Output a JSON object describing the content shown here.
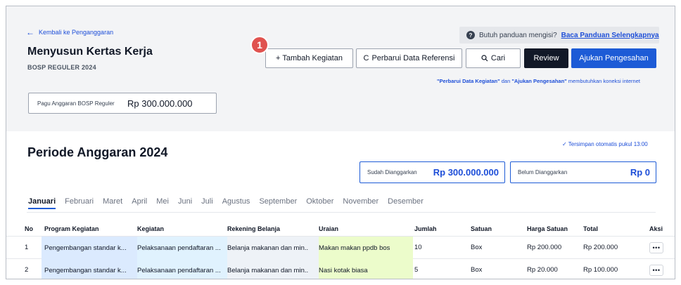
{
  "header": {
    "back_link": "Kembali ke Penganggaran",
    "title": "Menyusun Kertas Kerja",
    "subtitle": "BOSP REGULER 2024"
  },
  "help": {
    "text": "Butuh panduan mengisi?",
    "link": "Baca Panduan Selengkapnya"
  },
  "toolbar": {
    "add_label": "+ Tambah Kegiatan",
    "refresh_label": "Perbarui Data Referensi",
    "search_label": "Cari",
    "review_label": "Review",
    "submit_label": "Ajukan Pengesahan",
    "badge_number": "1"
  },
  "network_note": {
    "part1": "\"Perbarui Data Kegiatan\"",
    "part2": " dan ",
    "part3": "\"Ajukan Pengesahan\"",
    "part4": " membutuhkan koneksi internet"
  },
  "pagu": {
    "label": "Pagu Anggaran BOSP Reguler",
    "value": "Rp 300.000.000"
  },
  "period": {
    "title": "Periode Anggaran 2024",
    "autosave": "✓ Tersimpan otomatis pukul 13:00",
    "done_label": "Sudah Dianggarkan",
    "done_value": "Rp 300.000.000",
    "remain_label": "Belum Dianggarkan",
    "remain_value": "Rp 0"
  },
  "months": [
    "Januari",
    "Februari",
    "Maret",
    "April",
    "Mei",
    "Juni",
    "Juli",
    "Agustus",
    "September",
    "Oktober",
    "November",
    "Desember"
  ],
  "table": {
    "headers": {
      "no": "No",
      "program": "Program Kegiatan",
      "kegiatan": "Kegiatan",
      "rekening": "Rekening Belanja",
      "uraian": "Uraian",
      "jumlah": "Jumlah",
      "satuan": "Satuan",
      "harga": "Harga Satuan",
      "total": "Total",
      "aksi": "Aksi"
    },
    "rows": [
      {
        "no": "1",
        "program": "Pengembangan standar k...",
        "kegiatan": "Pelaksanaan pendaftaran ...",
        "rekening": "Belanja makanan dan min..",
        "uraian": "Makan makan ppdb bos",
        "jumlah": "10",
        "satuan": "Box",
        "harga": "Rp 200.000",
        "total": "Rp 200.000",
        "aksi": "•••"
      },
      {
        "no": "2",
        "program": "Pengembangan standar k...",
        "kegiatan": "Pelaksanaan pendaftaran ...",
        "rekening": "Belanja makanan dan min..",
        "uraian": "Nasi kotak biasa",
        "jumlah": "5",
        "satuan": "Box",
        "harga": "Rp 20.000",
        "total": "Rp 100.000",
        "aksi": "•••"
      }
    ]
  },
  "colors": {
    "accent": "#1d5bd6",
    "badge": "#e0524f",
    "review_button": "#111827"
  }
}
